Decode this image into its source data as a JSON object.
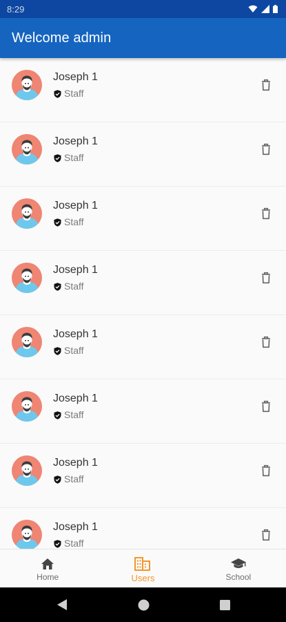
{
  "status_bar": {
    "time": "8:29"
  },
  "app_bar": {
    "title": "Welcome admin"
  },
  "users": [
    {
      "name": "Joseph 1",
      "role": "Staff"
    },
    {
      "name": "Joseph 1",
      "role": "Staff"
    },
    {
      "name": "Joseph 1",
      "role": "Staff"
    },
    {
      "name": "Joseph 1",
      "role": "Staff"
    },
    {
      "name": "Joseph 1",
      "role": "Staff"
    },
    {
      "name": "Joseph 1",
      "role": "Staff"
    },
    {
      "name": "Joseph 1",
      "role": "Staff"
    },
    {
      "name": "Joseph 1",
      "role": "Staff"
    }
  ],
  "bottom_nav": {
    "items": [
      {
        "label": "Home",
        "icon": "home-icon",
        "active": false
      },
      {
        "label": "Users",
        "icon": "building-icon",
        "active": true
      },
      {
        "label": "School",
        "icon": "school-icon",
        "active": false
      }
    ]
  },
  "colors": {
    "primary": "#1565c0",
    "status_bar": "#0d47a1",
    "accent": "#f7942a"
  }
}
